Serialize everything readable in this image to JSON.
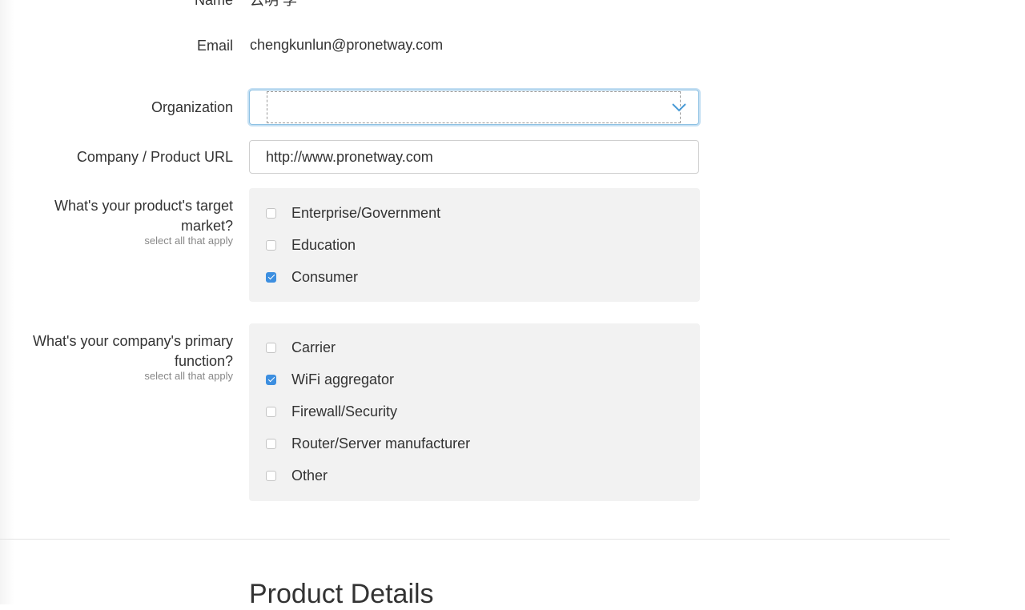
{
  "form": {
    "name": {
      "label": "Name",
      "value": "云明 李"
    },
    "email": {
      "label": "Email",
      "value": "chengkunlun@pronetway.com"
    },
    "organization": {
      "label": "Organization",
      "selected": ""
    },
    "url": {
      "label": "Company / Product URL",
      "value": "http://www.pronetway.com"
    },
    "target_market": {
      "label": "What's your product's target market?",
      "hint": "select all that apply",
      "options": [
        {
          "label": "Enterprise/Government",
          "checked": false
        },
        {
          "label": "Education",
          "checked": false
        },
        {
          "label": "Consumer",
          "checked": true
        }
      ]
    },
    "primary_function": {
      "label": "What's your company's primary function?",
      "hint": "select all that apply",
      "options": [
        {
          "label": "Carrier",
          "checked": false
        },
        {
          "label": "WiFi aggregator",
          "checked": true
        },
        {
          "label": "Firewall/Security",
          "checked": false
        },
        {
          "label": "Router/Server manufacturer",
          "checked": false
        },
        {
          "label": "Other",
          "checked": false
        }
      ]
    }
  },
  "section": {
    "title": "Product Details"
  },
  "colors": {
    "accent": "#3d8fe0",
    "focus": "#8ec1e3",
    "panel": "#f2f2f2"
  },
  "icons": {
    "select_chevron": "chevron-down-icon",
    "check": "checkmark-icon"
  }
}
